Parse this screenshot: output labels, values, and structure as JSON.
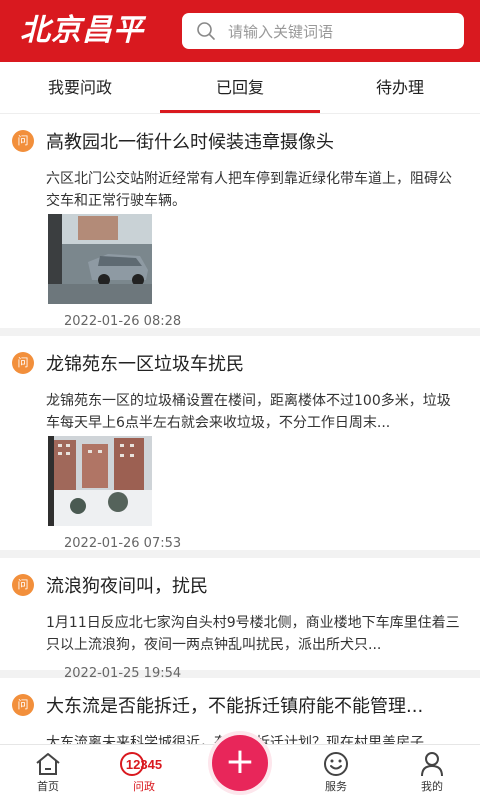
{
  "header": {
    "logo_text": "北京昌平",
    "search_placeholder": "请输入关键词语"
  },
  "tabs": [
    {
      "label": "我要问政"
    },
    {
      "label": "已回复"
    },
    {
      "label": "待办理"
    }
  ],
  "items": [
    {
      "icon_text": "问",
      "title": "高教园北一街什么时候装违章摄像头",
      "desc": "六区北门公交站附近经常有人把车停到靠近绿化带车道上，阻碍公交车和正常行驶车辆。",
      "date": "2022-01-26 08:28"
    },
    {
      "icon_text": "问",
      "title": "龙锦苑东一区垃圾车扰民",
      "desc": "龙锦苑东一区的垃圾桶设置在楼间，距离楼体不过100多米，垃圾车每天早上6点半左右就会来收垃圾，不分工作日周末...",
      "date": "2022-01-26 07:53"
    },
    {
      "icon_text": "问",
      "title": "流浪狗夜间叫，扰民",
      "desc": "1月11日反应北七家沟自头村9号楼北侧，商业楼地下车库里住着三只以上流浪狗，夜间一两点钟乱叫扰民，派出所犬只...",
      "date": "2022-01-25 19:54"
    },
    {
      "icon_text": "问",
      "title": "大东流是否能拆迁，不能拆迁镇府能不能管理...",
      "desc": "大东流离未来科学城很近，有没有拆迁计划？现在村里盖房子",
      "date": ""
    }
  ],
  "tabbar": [
    {
      "label": "首页"
    },
    {
      "label": "问政",
      "badge_text": "12345"
    },
    {
      "label": ""
    },
    {
      "label": "服务"
    },
    {
      "label": "我的"
    }
  ],
  "colors": {
    "brand_red": "#d9191f",
    "question_orange": "#f28f3b",
    "plus_pink": "#e8265a"
  }
}
